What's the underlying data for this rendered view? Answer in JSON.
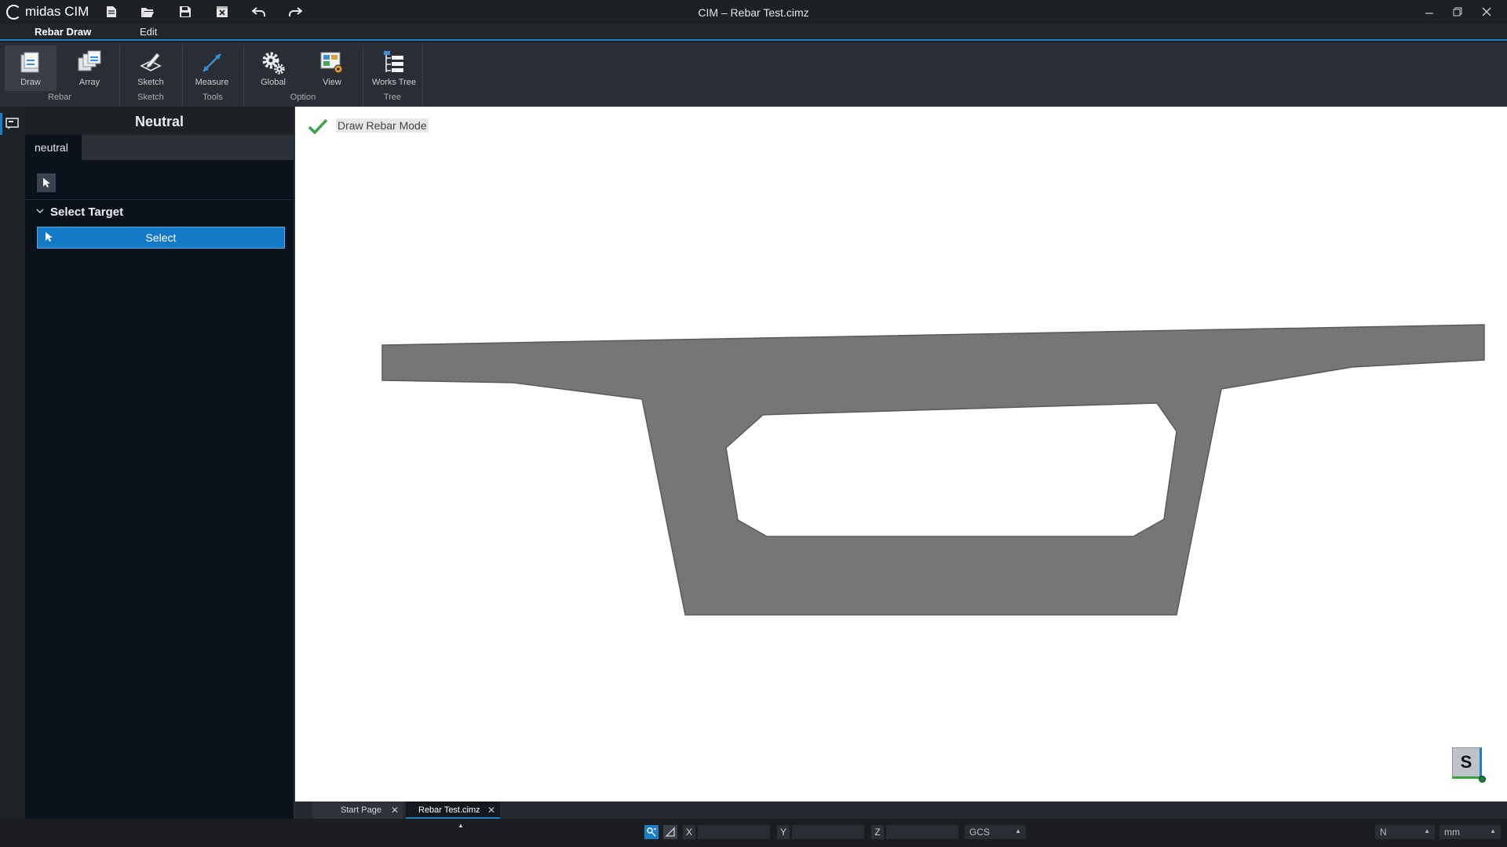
{
  "app": {
    "logo_text": "midas CIM",
    "window_title": "CIM – Rebar Test.cimz"
  },
  "ribbon": {
    "tabs": [
      {
        "label": "Rebar Draw",
        "active": true
      },
      {
        "label": "Edit",
        "active": false
      }
    ],
    "buttons": {
      "draw": "Draw",
      "array": "Array",
      "sketch": "Sketch",
      "measure": "Measure",
      "global": "Global",
      "view": "View",
      "works_tree": "Works Tree"
    },
    "groups": {
      "rebar": "Rebar",
      "sketch": "Sketch",
      "tools": "Tools",
      "option": "Option",
      "tree": "Tree"
    }
  },
  "panel": {
    "title": "Neutral",
    "tab": "neutral",
    "section": "Select Target",
    "select_button": "Select"
  },
  "viewport": {
    "mode_label": "Draw Rebar Mode",
    "snap_indicator": "S",
    "colors": {
      "section_fill": "#767676",
      "section_stroke": "#5a5a5a",
      "background": "#ffffff"
    }
  },
  "doc_tabs": [
    {
      "label": "Start Page",
      "active": false
    },
    {
      "label": "Rebar Test.cimz",
      "active": true
    }
  ],
  "statusbar": {
    "axes": [
      "X",
      "Y",
      "Z"
    ],
    "x_value": "",
    "y_value": "",
    "z_value": "",
    "coord_system": "GCS",
    "force_unit": "N",
    "length_unit": "mm"
  },
  "theme": {
    "accent": "#1c7fc4",
    "panel_bg": "#0b121c",
    "check_color": "#3fa34d"
  }
}
